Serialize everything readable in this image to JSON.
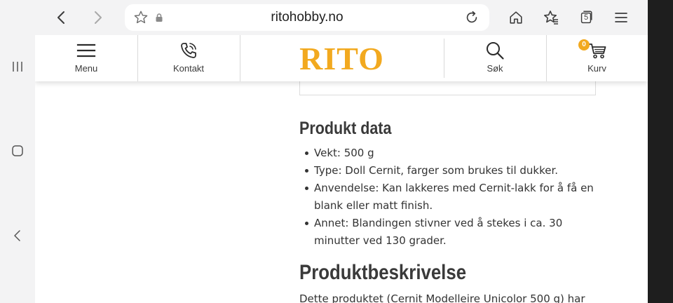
{
  "browser": {
    "url": "ritohobby.no",
    "tab_count": "5"
  },
  "header": {
    "nav": {
      "menu_label": "Menu",
      "contact_label": "Kontakt",
      "search_label": "Søk",
      "cart_label": "Kurv"
    },
    "logo_text": "RITO",
    "cart_count": "0",
    "colors": {
      "brand": "#f2a91f",
      "text": "#3a3a3a"
    }
  },
  "content": {
    "product_data_heading": "Produkt data",
    "product_data_items": [
      "Vekt: 500 g",
      "Type: Doll Cernit, farger som brukes til dukker.",
      "Anvendelse: Kan lakkeres med Cernit-lakk for å få en blank eller matt finish.",
      "Annet: Blandingen stivner ved å stekes i ca. 30 minutter ved 130 grader."
    ],
    "description_heading": "Produktbeskrivelse",
    "description_text": "Dette produktet (Cernit Modelleire Unicolor 500 g) har"
  }
}
